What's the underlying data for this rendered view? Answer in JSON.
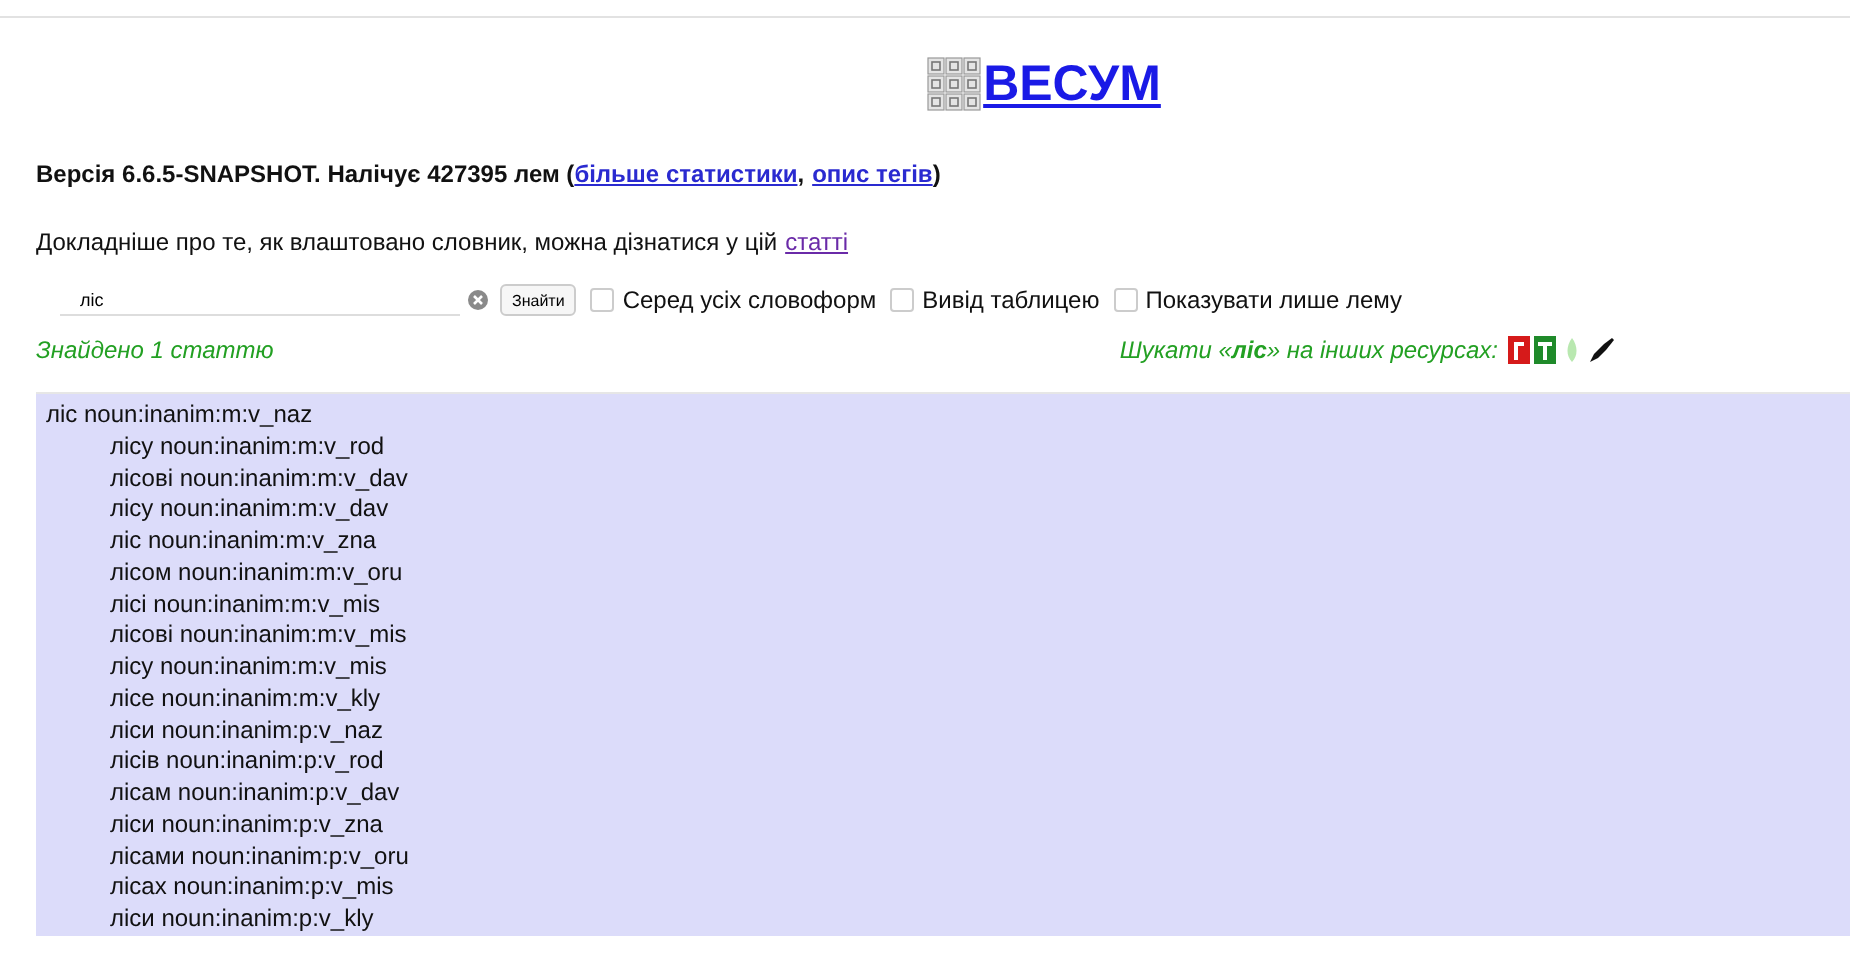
{
  "header": {
    "title": "ВЕСУМ"
  },
  "version_line": {
    "text": "**Версія 6.6.5-SNAPSHOT. Налічує 427395 лем (**",
    "links": [
      "більше статистики",
      "опис тегів"
    ],
    "separator": ",",
    "closing": ")"
  },
  "intro": {
    "text": "Докладніше про те, як влаштовано словник, можна дізнатися у цій",
    "link": "статті"
  },
  "search": {
    "value": "ліс",
    "button": "Знайти",
    "options": [
      {
        "label": "Серед усіх словоформ",
        "checked": false
      },
      {
        "label": "Вивід таблицею",
        "checked": false
      },
      {
        "label": "Показувати лише лему",
        "checked": false
      }
    ]
  },
  "result_count": "Знайдено 1 статтю",
  "other_resources": {
    "label": "Шукати «**ліс**» на інших ресурсах:"
  },
  "entry": {
    "lemma": "ліс noun:inanim:m:v_naz",
    "forms": [
      "лісу noun:inanim:m:v_rod",
      "лісові noun:inanim:m:v_dav",
      "лісу noun:inanim:m:v_dav",
      "ліс noun:inanim:m:v_zna",
      "лісом noun:inanim:m:v_oru",
      "лісі noun:inanim:m:v_mis",
      "лісові noun:inanim:m:v_mis",
      "лісу noun:inanim:m:v_mis",
      "лісе noun:inanim:m:v_kly",
      "ліси noun:inanim:p:v_naz",
      "лісів noun:inanim:p:v_rod",
      "лісам noun:inanim:p:v_dav",
      "ліси noun:inanim:p:v_zna",
      "лісами noun:inanim:p:v_oru",
      "лісах noun:inanim:p:v_mis",
      "ліси noun:inanim:p:v_kly"
    ]
  }
}
